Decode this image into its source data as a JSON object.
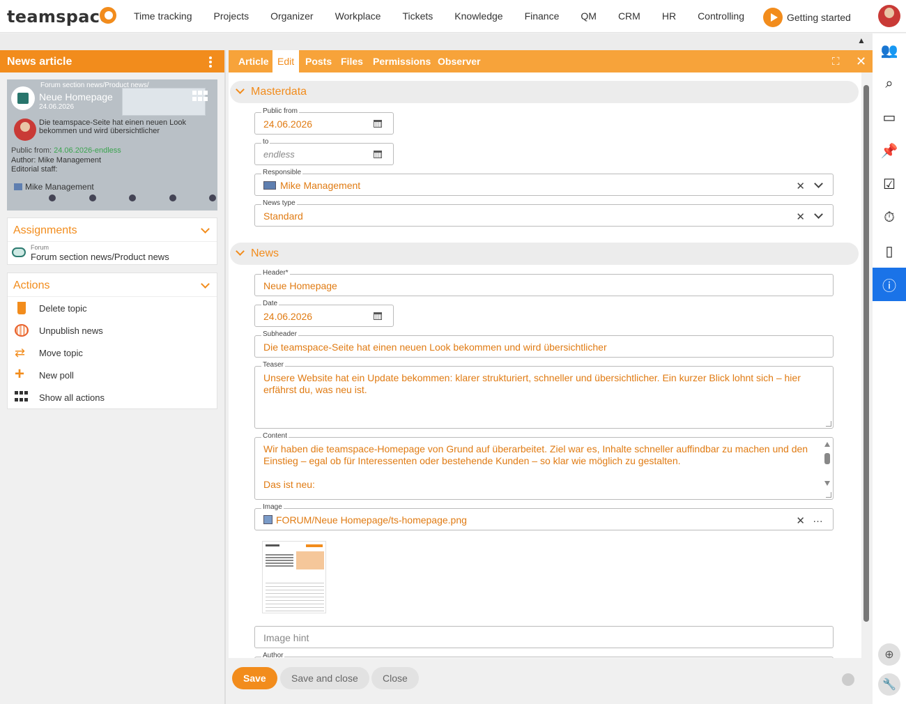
{
  "app": {
    "logo": "teamspace"
  },
  "nav": [
    "Time tracking",
    "Projects",
    "Organizer",
    "Workplace",
    "Tickets",
    "Knowledge",
    "Finance",
    "QM",
    "CRM",
    "HR",
    "Controlling"
  ],
  "getting_started": "Getting started",
  "left": {
    "title": "News article",
    "card": {
      "forum": "Forum section news/Product news/",
      "title": "Neue Homepage",
      "date": "24.06.2026",
      "subheader": "Die teamspace-Seite hat einen neuen Look bekommen und wird übersichtlicher",
      "public_from_label": "Public from:",
      "public_from_value": "24.06.2026-endless",
      "author": "Author: Mike Management",
      "editorial": "Editorial staff:",
      "person": "Mike Management"
    },
    "assignments": {
      "title": "Assignments",
      "label": "Forum",
      "value": "Forum section news/Product news"
    },
    "actions": {
      "title": "Actions",
      "items": [
        "Delete topic",
        "Unpublish news",
        "Move topic",
        "New poll",
        "Show all actions"
      ]
    }
  },
  "tabs": [
    "Article",
    "Edit",
    "Posts",
    "Files",
    "Permissions",
    "Observer"
  ],
  "active_tab": "Edit",
  "sections": {
    "masterdata": "Masterdata",
    "news": "News"
  },
  "fields": {
    "public_from": {
      "label": "Public from",
      "value": "24.06.2026"
    },
    "to": {
      "label": "to",
      "placeholder": "endless"
    },
    "responsible": {
      "label": "Responsible",
      "value": "Mike Management"
    },
    "news_type": {
      "label": "News type",
      "value": "Standard"
    },
    "header": {
      "label": "Header*",
      "value": "Neue Homepage"
    },
    "date": {
      "label": "Date",
      "value": "24.06.2026"
    },
    "subheader": {
      "label": "Subheader",
      "value": "Die teamspace-Seite hat einen neuen Look bekommen und wird übersichtlicher"
    },
    "teaser": {
      "label": "Teaser",
      "value": "Unsere Website hat ein Update bekommen: klarer strukturiert, schneller und übersichtlicher. Ein kurzer Blick lohnt sich – hier erfährst du, was neu ist."
    },
    "content": {
      "label": "Content",
      "line1": "Wir haben die teamspace-Homepage von Grund auf überarbeitet. Ziel war es, Inhalte schneller auffindbar zu machen und den Einstieg – egal ob für Interessenten oder bestehende Kunden – so klar wie möglich zu gestalten.",
      "line2": "Das ist neu:"
    },
    "image": {
      "label": "Image",
      "value": "FORUM/Neue Homepage/ts-homepage.png"
    },
    "image_hint": {
      "placeholder": "Image hint"
    },
    "author": {
      "label": "Author"
    }
  },
  "buttons": {
    "save": "Save",
    "save_close": "Save and close",
    "close": "Close"
  },
  "colors": {
    "accent": "#f28c1c",
    "tab_bar": "#f7a33a",
    "active_rail": "#1a73e8",
    "value_text": "#e07b13"
  },
  "rail_icons": [
    "users-icon",
    "search-icon",
    "inbox-icon",
    "pin-icon",
    "checklist-icon",
    "stopwatch-icon",
    "mobile-icon",
    "info-icon",
    "plus-circle-icon",
    "wrench-icon"
  ]
}
